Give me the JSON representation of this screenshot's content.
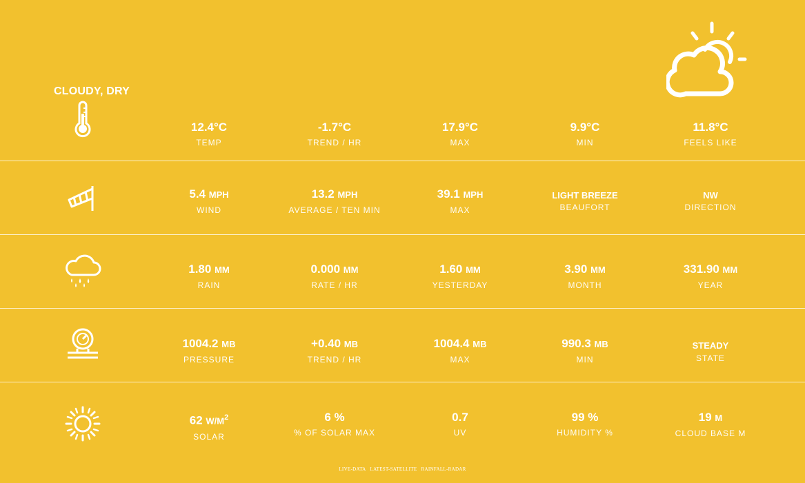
{
  "condition": "CLOUDY, DRY",
  "icons": {
    "condition": "sun-cloud-icon"
  },
  "rows": [
    {
      "icon": "thermometer-icon",
      "cells": [
        {
          "value": "12.4°C",
          "unit": "",
          "label": "TEMP"
        },
        {
          "value": "-1.7°C",
          "unit": "",
          "label": "TREND / HR"
        },
        {
          "value": "17.9°C",
          "unit": "",
          "label": "MAX"
        },
        {
          "value": "9.9°C",
          "unit": "",
          "label": "MIN"
        },
        {
          "value": "11.8°C",
          "unit": "",
          "label": "FEELS LIKE"
        }
      ]
    },
    {
      "icon": "windsock-icon",
      "cells": [
        {
          "value": "5.4",
          "unit": "MPH",
          "label": "WIND"
        },
        {
          "value": "13.2",
          "unit": "MPH",
          "label": "AVERAGE / TEN MIN"
        },
        {
          "value": "39.1",
          "unit": "MPH",
          "label": "MAX"
        },
        {
          "value": "LIGHT BREEZE",
          "unit": "",
          "label": "BEAUFORT"
        },
        {
          "value": "NW",
          "unit": "",
          "label": "DIRECTION"
        }
      ]
    },
    {
      "icon": "rain-cloud-icon",
      "cells": [
        {
          "value": "1.80",
          "unit": "MM",
          "label": "RAIN"
        },
        {
          "value": "0.000",
          "unit": "MM",
          "label": "RATE / HR"
        },
        {
          "value": "1.60",
          "unit": "MM",
          "label": "YESTERDAY"
        },
        {
          "value": "3.90",
          "unit": "MM",
          "label": "MONTH"
        },
        {
          "value": "331.90",
          "unit": "MM",
          "label": "YEAR"
        }
      ]
    },
    {
      "icon": "barometer-icon",
      "cells": [
        {
          "value": "1004.2",
          "unit": "MB",
          "label": "PRESSURE"
        },
        {
          "value": "+0.40",
          "unit": "MB",
          "label": "TREND / HR"
        },
        {
          "value": "1004.4",
          "unit": "MB",
          "label": "MAX"
        },
        {
          "value": "990.3",
          "unit": "MB",
          "label": "MIN"
        },
        {
          "value": "STEADY",
          "unit": "",
          "label": "STATE"
        }
      ]
    },
    {
      "icon": "sun-icon",
      "cells": [
        {
          "value": "62",
          "unit": "W/M",
          "label": "SOLAR"
        },
        {
          "value": "6 %",
          "unit": "",
          "label": "% OF SOLAR MAX"
        },
        {
          "value": "0.7",
          "unit": "",
          "label": "UV"
        },
        {
          "value": "99 %",
          "unit": "",
          "label": "HUMIDITY %"
        },
        {
          "value": "19",
          "unit": "M",
          "label": "CLOUD BASE M"
        }
      ]
    }
  ],
  "solar_unit_superscript": "2",
  "footer_links": [
    "LIVE-DATA",
    "LATEST-SATELLITE",
    "RAINFALL-RADAR"
  ],
  "colors": {
    "background": "#f2c12e",
    "foreground": "#ffffff"
  }
}
